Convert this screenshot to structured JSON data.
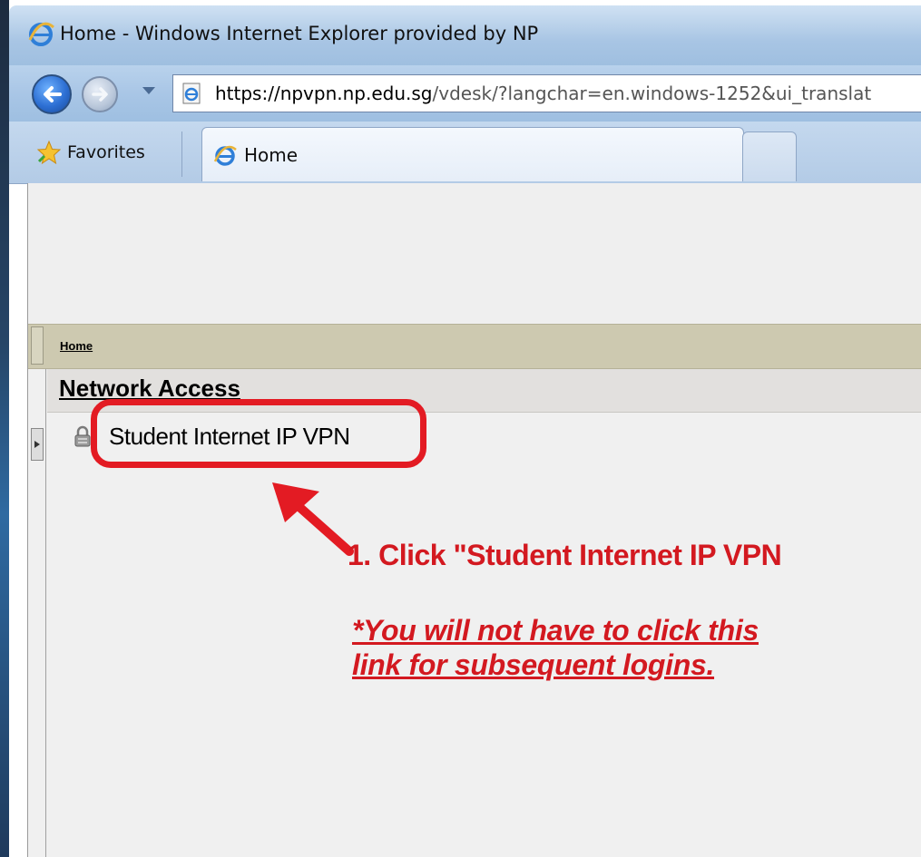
{
  "browser": {
    "title": "Home - Windows Internet Explorer provided by NP",
    "address": {
      "host": "https://npvpn.np.edu.sg",
      "path": "/vdesk/?langchar=en.windows-1252&ui_translat"
    },
    "favorites_label": "Favorites",
    "tab_label": "Home",
    "icons": {
      "ie": "ie-logo-icon",
      "back": "back-arrow-icon",
      "forward": "forward-arrow-icon",
      "favorites": "star-icon",
      "page": "page-icon"
    }
  },
  "page": {
    "breadcrumb": "Home",
    "section_title": "Network Access",
    "resource_link": "Student Internet IP VPN",
    "resource_icon": "lock-icon"
  },
  "annotation": {
    "step": "1. Click \"Student Internet IP VPN",
    "note_line1": "*You will not have to click this",
    "note_line2": "link for subsequent logins.",
    "color": "#d31920"
  }
}
